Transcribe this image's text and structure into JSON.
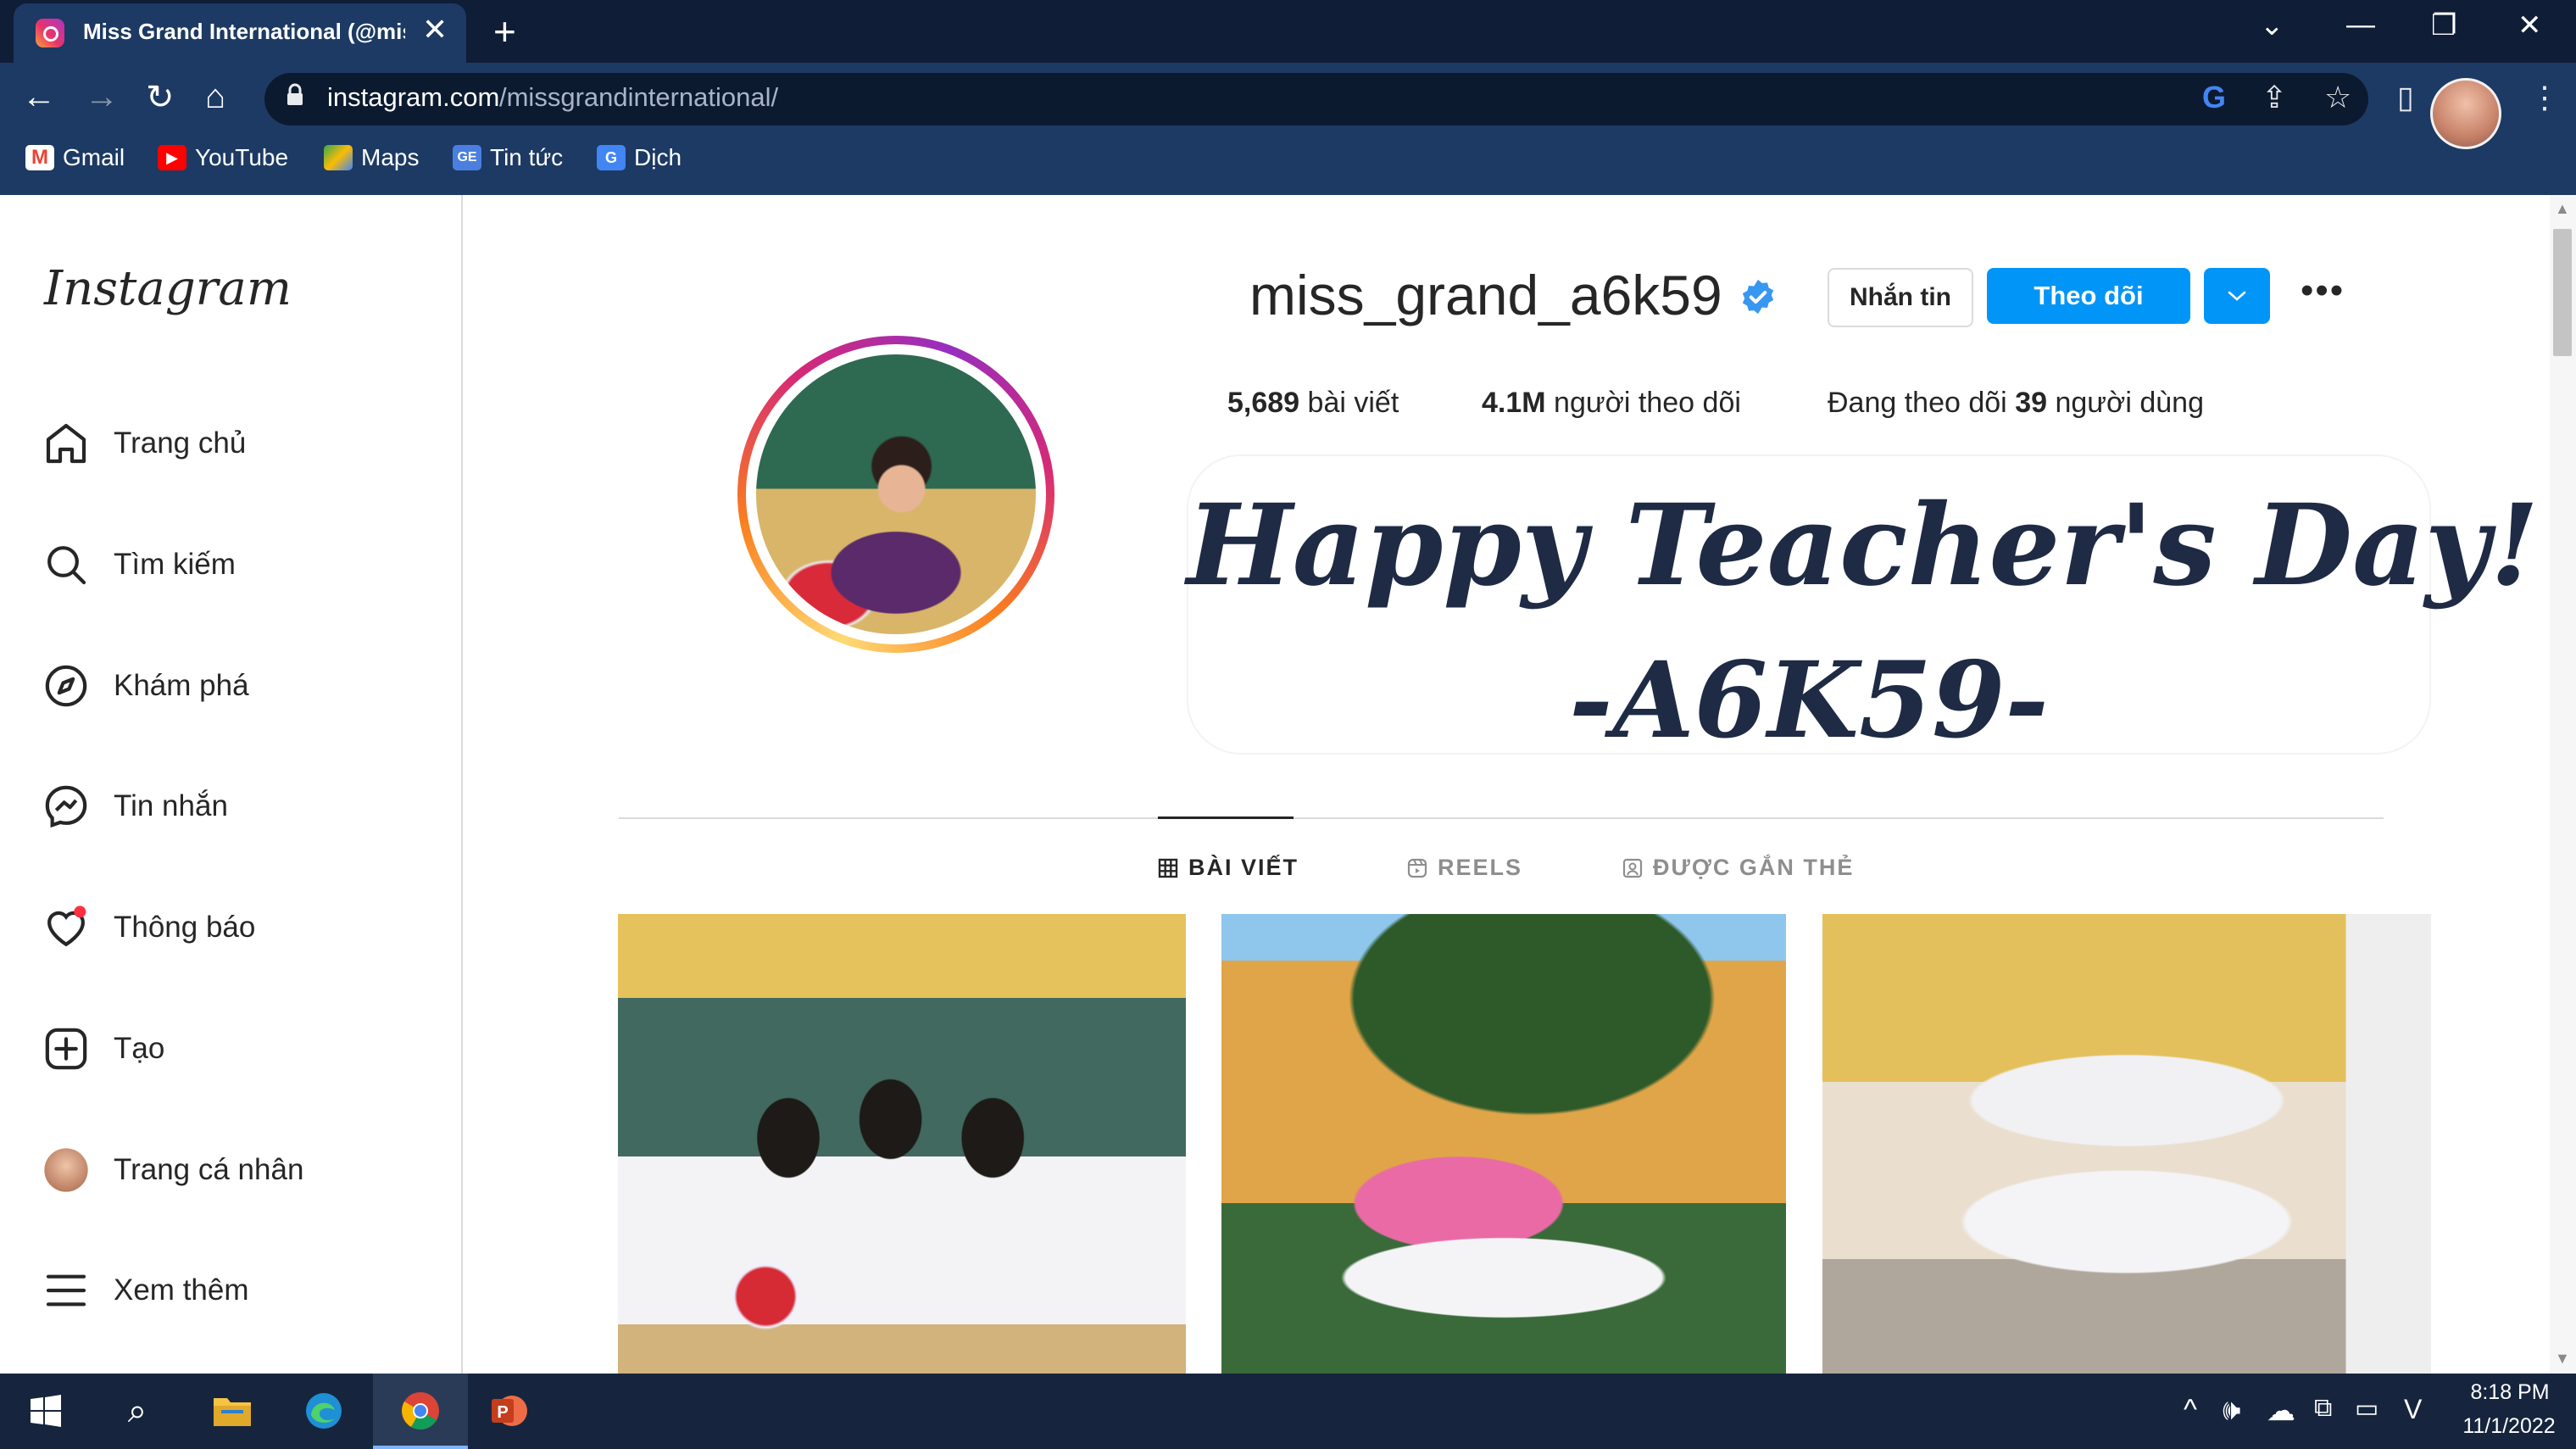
{
  "browser": {
    "tab_title": "Miss Grand International (@mis",
    "url_host": "instagram.com",
    "url_path": "/missgrandinternational/",
    "bookmarks": [
      {
        "label": "Gmail",
        "icon": "gmail-icon"
      },
      {
        "label": "YouTube",
        "icon": "youtube-icon"
      },
      {
        "label": "Maps",
        "icon": "maps-icon"
      },
      {
        "label": "Tin tức",
        "icon": "news-icon"
      },
      {
        "label": "Dịch",
        "icon": "translate-icon"
      }
    ]
  },
  "sidebar": {
    "logo": "Instagram",
    "items": [
      {
        "label": "Trang chủ",
        "icon": "home-icon"
      },
      {
        "label": "Tìm kiếm",
        "icon": "search-icon"
      },
      {
        "label": "Khám phá",
        "icon": "compass-icon"
      },
      {
        "label": "Tin nhắn",
        "icon": "messenger-icon"
      },
      {
        "label": "Thông báo",
        "icon": "heart-icon"
      },
      {
        "label": "Tạo",
        "icon": "plus-square-icon"
      },
      {
        "label": "Trang cá nhân",
        "icon": "avatar"
      },
      {
        "label": "Xem thêm",
        "icon": "menu-icon"
      }
    ]
  },
  "profile": {
    "username": "miss_grand_a6k59",
    "verified": true,
    "message_button": "Nhắn tin",
    "follow_button": "Theo dõi",
    "more_button": "•••",
    "posts_count": "5,689",
    "posts_label": "bài viết",
    "followers_count": "4.1M",
    "followers_label": "người theo dõi",
    "following_prefix": "Đang theo dõi",
    "following_count": "39",
    "following_label": "người dùng",
    "bio_line1": "Happy Teacher's Day!",
    "bio_line2": "-A6K59-"
  },
  "tabs": [
    {
      "label": "BÀI VIẾT",
      "icon": "grid-icon",
      "active": true
    },
    {
      "label": "REELS",
      "icon": "reels-icon",
      "active": false
    },
    {
      "label": "ĐƯỢC GẮN THẺ",
      "icon": "tagged-icon",
      "active": false
    }
  ],
  "posts": [
    "class-photo-classroom",
    "class-photo-schoolyard",
    "class-photo-boys"
  ],
  "taskbar": {
    "time": "8:18 PM",
    "date": "11/1/2022"
  },
  "colors": {
    "accent": "#0095f6",
    "chrome_title": "#0f1d37",
    "chrome_toolbar": "#1c3a63",
    "taskbar": "#16253d"
  }
}
